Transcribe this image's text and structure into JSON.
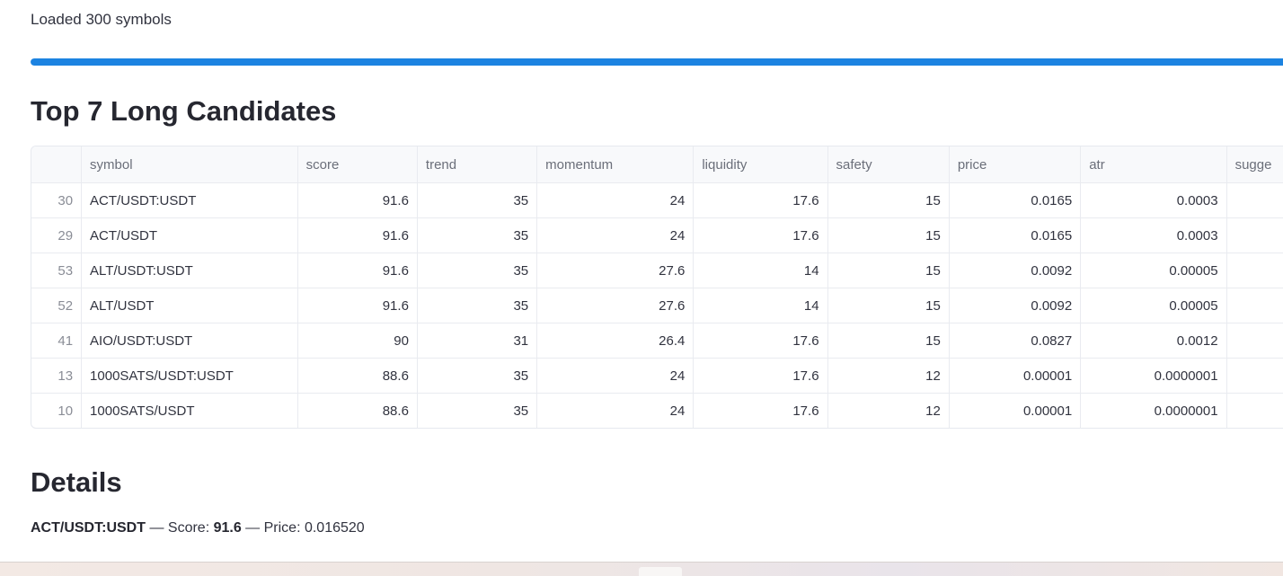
{
  "status": {
    "loaded_text": "Loaded 300 symbols",
    "progress_percent": 100,
    "progress_color": "#1c83e1"
  },
  "candidates_section": {
    "title": "Top 7 Long Candidates"
  },
  "table": {
    "columns": [
      "symbol",
      "score",
      "trend",
      "momentum",
      "liquidity",
      "safety",
      "price",
      "atr",
      "sugge"
    ],
    "rows": [
      {
        "index": "30",
        "symbol": "ACT/USDT:USDT",
        "score": "91.6",
        "trend": "35",
        "momentum": "24",
        "liquidity": "17.6",
        "safety": "15",
        "price": "0.0165",
        "atr": "0.0003"
      },
      {
        "index": "29",
        "symbol": "ACT/USDT",
        "score": "91.6",
        "trend": "35",
        "momentum": "24",
        "liquidity": "17.6",
        "safety": "15",
        "price": "0.0165",
        "atr": "0.0003"
      },
      {
        "index": "53",
        "symbol": "ALT/USDT:USDT",
        "score": "91.6",
        "trend": "35",
        "momentum": "27.6",
        "liquidity": "14",
        "safety": "15",
        "price": "0.0092",
        "atr": "0.00005"
      },
      {
        "index": "52",
        "symbol": "ALT/USDT",
        "score": "91.6",
        "trend": "35",
        "momentum": "27.6",
        "liquidity": "14",
        "safety": "15",
        "price": "0.0092",
        "atr": "0.00005"
      },
      {
        "index": "41",
        "symbol": "AIO/USDT:USDT",
        "score": "90",
        "trend": "31",
        "momentum": "26.4",
        "liquidity": "17.6",
        "safety": "15",
        "price": "0.0827",
        "atr": "0.0012"
      },
      {
        "index": "13",
        "symbol": "1000SATS/USDT:USDT",
        "score": "88.6",
        "trend": "35",
        "momentum": "24",
        "liquidity": "17.6",
        "safety": "12",
        "price": "0.00001",
        "atr": "0.0000001"
      },
      {
        "index": "10",
        "symbol": "1000SATS/USDT",
        "score": "88.6",
        "trend": "35",
        "momentum": "24",
        "liquidity": "17.6",
        "safety": "12",
        "price": "0.00001",
        "atr": "0.0000001"
      }
    ]
  },
  "details_section": {
    "title": "Details",
    "symbol": "ACT/USDT:USDT",
    "score_label": " — Score: ",
    "score_value": "91.6",
    "price_label": " — Price: 0.016520"
  }
}
